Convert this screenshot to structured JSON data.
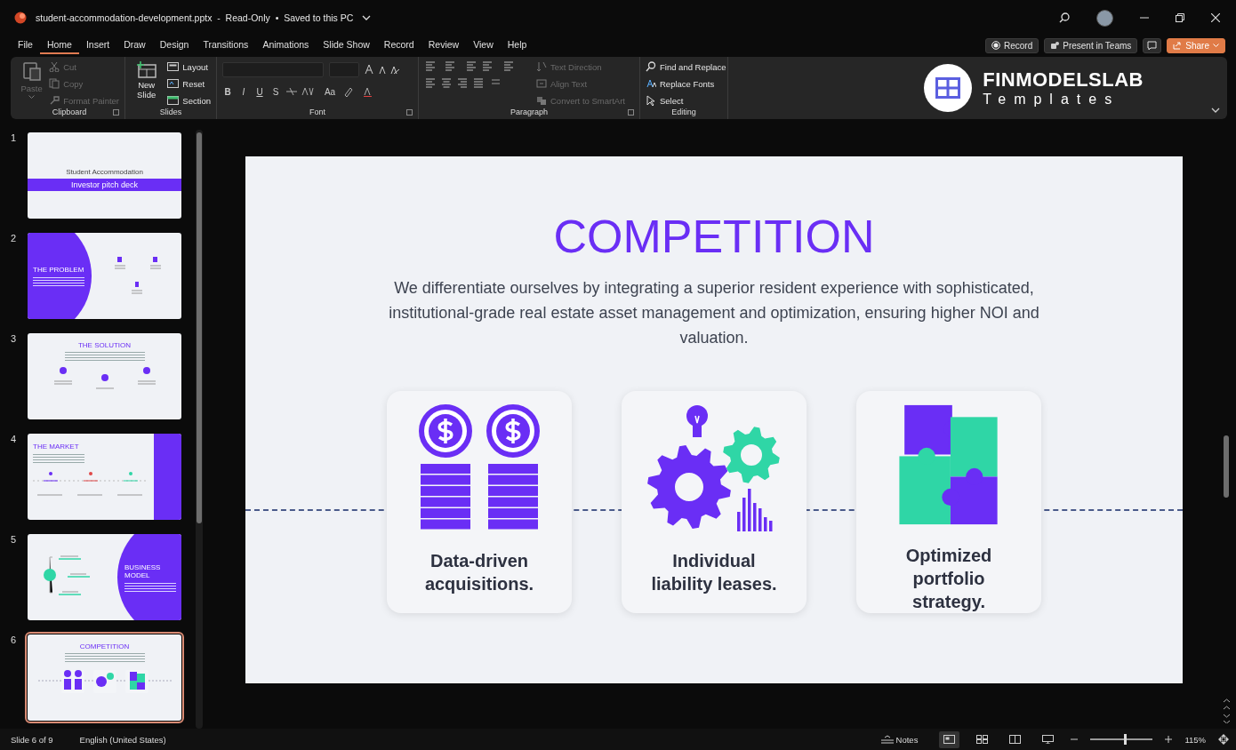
{
  "window": {
    "title": "student-accommodation-development.pptx  -  Read-Only  •  Saved to this PC"
  },
  "menu_tabs": [
    {
      "label": "File",
      "selected": false
    },
    {
      "label": "Home",
      "selected": true
    },
    {
      "label": "Insert",
      "selected": false
    },
    {
      "label": "Draw",
      "selected": false
    },
    {
      "label": "Design",
      "selected": false
    },
    {
      "label": "Transitions",
      "selected": false
    },
    {
      "label": "Animations",
      "selected": false
    },
    {
      "label": "Slide Show",
      "selected": false
    },
    {
      "label": "Record",
      "selected": false
    },
    {
      "label": "Review",
      "selected": false
    },
    {
      "label": "View",
      "selected": false
    },
    {
      "label": "Help",
      "selected": false
    }
  ],
  "header_buttons": [
    {
      "label": "Record",
      "kind": "record"
    },
    {
      "label": "Present in Teams",
      "kind": "teams"
    },
    {
      "label": "Share",
      "kind": "share"
    }
  ],
  "ribbon": {
    "groups": [
      {
        "name": "Clipboard",
        "kind": "clipboard",
        "items": [
          {
            "label": "Paste",
            "disabled": true
          },
          {
            "label": "Cut",
            "disabled": true
          },
          {
            "label": "Copy",
            "disabled": true
          },
          {
            "label": "Format Painter",
            "disabled": true
          }
        ]
      },
      {
        "name": "Slides",
        "kind": "slides",
        "items": [
          {
            "label": "New Slide",
            "disabled": false
          },
          {
            "label": "Layout",
            "disabled": false
          },
          {
            "label": "Reset",
            "disabled": false
          },
          {
            "label": "Section",
            "disabled": false
          }
        ]
      },
      {
        "name": "Font",
        "kind": "font",
        "items": [
          {
            "label": "B",
            "disabled": false
          },
          {
            "label": "I",
            "disabled": false
          },
          {
            "label": "U",
            "disabled": false
          },
          {
            "label": "S",
            "disabled": false
          },
          {
            "label": "Aa",
            "disabled": false
          }
        ]
      },
      {
        "name": "Paragraph",
        "kind": "paragraph",
        "items": [
          {
            "label": "Text Direction",
            "disabled": true
          },
          {
            "label": "Align Text",
            "disabled": true
          },
          {
            "label": "Convert to SmartArt",
            "disabled": true
          }
        ]
      },
      {
        "name": "Editing",
        "kind": "editing",
        "items": [
          {
            "label": "Find and Replace",
            "disabled": false
          },
          {
            "label": "Replace Fonts",
            "disabled": false
          },
          {
            "label": "Select",
            "disabled": false
          }
        ]
      }
    ]
  },
  "logo": {
    "name": "FINMODELSLAB",
    "tagline": "Templates"
  },
  "slides": [
    {
      "number": "1",
      "kind": "title",
      "title": "Student Accommodation",
      "subtitle": "Investor pitch deck",
      "selected": false
    },
    {
      "number": "2",
      "kind": "circle-left",
      "title": "THE PROBLEM",
      "selected": false
    },
    {
      "number": "3",
      "kind": "centered",
      "title": "THE SOLUTION",
      "selected": false
    },
    {
      "number": "4",
      "kind": "band-right",
      "title": "THE MARKET",
      "selected": false
    },
    {
      "number": "5",
      "kind": "circle-right",
      "title": "BUSINESS MODEL",
      "selected": false
    },
    {
      "number": "6",
      "kind": "centered",
      "title": "COMPETITION",
      "selected": true
    }
  ],
  "slide": {
    "title": "COMPETITION",
    "text": "We differentiate ourselves by integrating a superior resident experience with sophisticated, institutional-grade real estate asset management and optimization, ensuring higher NOI and valuation.",
    "cards": [
      {
        "kind": "coins",
        "lines": [
          "Data-driven",
          "acquisitions."
        ]
      },
      {
        "kind": "gears",
        "lines": [
          "Individual",
          "liability leases."
        ]
      },
      {
        "kind": "puzzle",
        "lines": [
          "Optimized",
          "portfolio",
          "strategy."
        ]
      }
    ]
  },
  "status_bar": {
    "slide": "Slide 6 of 9",
    "language": "English (United States)",
    "notes": "Notes",
    "views": [
      {
        "kind": "normal",
        "selected": true
      },
      {
        "kind": "sorter",
        "selected": false
      },
      {
        "kind": "reading",
        "selected": false
      },
      {
        "kind": "slideshow",
        "selected": false
      }
    ],
    "zoom_slider": {
      "level": 0.55
    },
    "zoom": "115%"
  }
}
